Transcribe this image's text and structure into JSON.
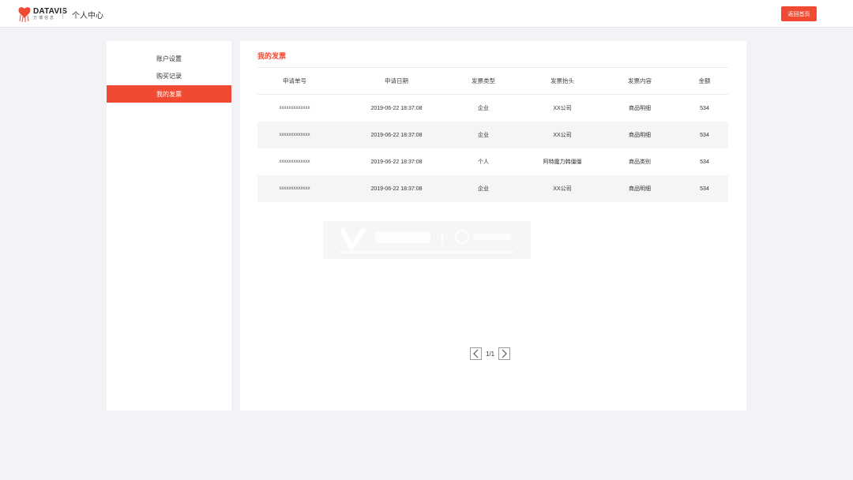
{
  "header": {
    "logo_text": "DATAVIS",
    "logo_sub": "万博信息",
    "page_title": "个人中心",
    "home_button": "返回首页"
  },
  "colors": {
    "accent": "#f04a32",
    "background": "#f2f3f7",
    "row_alt": "#f5f5f5"
  },
  "sidebar": {
    "items": [
      {
        "label": "账户设置",
        "active": false
      },
      {
        "label": "购买记录",
        "active": false
      },
      {
        "label": "我的发票",
        "active": true
      }
    ]
  },
  "main": {
    "title": "我的发票",
    "columns": [
      "申请单号",
      "申请日期",
      "发票类型",
      "发票抬头",
      "发票内容",
      "金额"
    ],
    "rows": [
      [
        "xxxxxxxxxxxxx",
        "2019-06-22 18:37:08",
        "企业",
        "XX公司",
        "商品明细",
        "534"
      ],
      [
        "xxxxxxxxxxxxx",
        "2019-06-22 18:37:08",
        "企业",
        "XX公司",
        "商品明细",
        "534"
      ],
      [
        "xxxxxxxxxxxxx",
        "2019-06-22 18:37:08",
        "个人",
        "阿特魔力韩僵僵",
        "商品类别",
        "534"
      ],
      [
        "xxxxxxxxxxxxx",
        "2019-06-22 18:37:08",
        "企业",
        "XX公司",
        "商品明细",
        "534"
      ]
    ],
    "pagination": {
      "text": "1/1",
      "prev_icon": "chevron-left-icon",
      "next_icon": "chevron-right-icon"
    }
  }
}
